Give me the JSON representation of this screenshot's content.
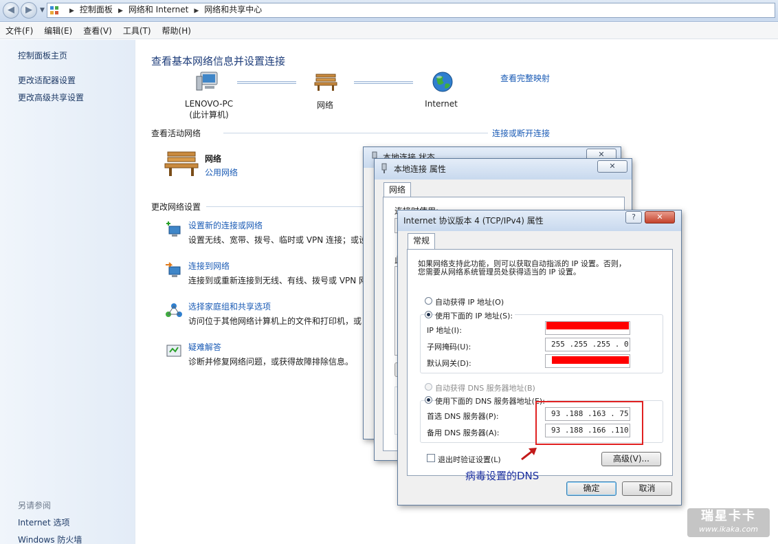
{
  "address_bar": {
    "breadcrumbs": [
      "控制面板",
      "网络和 Internet",
      "网络和共享中心"
    ]
  },
  "menu": [
    "文件(F)",
    "编辑(E)",
    "查看(V)",
    "工具(T)",
    "帮助(H)"
  ],
  "sidebar": {
    "items": [
      "控制面板主页",
      "更改适配器设置",
      "更改高级共享设置"
    ],
    "see_also_label": "另请参阅",
    "see_also": [
      "Internet 选项",
      "Windows 防火墙"
    ]
  },
  "main": {
    "title": "查看基本网络信息并设置连接",
    "full_map_link": "查看完整映射",
    "map_nodes": [
      {
        "line1": "LENOVO-PC",
        "line2": "(此计算机)"
      },
      {
        "line1": "网络",
        "line2": ""
      },
      {
        "line1": "Internet",
        "line2": ""
      }
    ],
    "active_header": "查看活动网络",
    "connect_link": "连接或断开连接",
    "active_network": {
      "name": "网络",
      "type": "公用网络"
    },
    "change_header": "更改网络设置",
    "tasks": [
      {
        "title": "设置新的连接或网络",
        "desc": "设置无线、宽带、拨号、临时或 VPN 连接；或设"
      },
      {
        "title": "连接到网络",
        "desc": "连接到或重新连接到无线、有线、拨号或 VPN 网"
      },
      {
        "title": "选择家庭组和共享选项",
        "desc": "访问位于其他网络计算机上的文件和打印机，或"
      },
      {
        "title": "疑难解答",
        "desc": "诊断并修复网络问题，或获得故障排除信息。"
      }
    ]
  },
  "status_dialog": {
    "title": "本地连接 状态"
  },
  "props_dialog": {
    "title": "本地连接 属性",
    "tab": "网络",
    "connect_using": "连接时使用:",
    "partial_label": "此"
  },
  "ipv4_dialog": {
    "title": "Internet 协议版本 4 (TCP/IPv4) 属性",
    "help_button": "?",
    "tab": "常规",
    "intro_line1": "如果网络支持此功能，则可以获取自动指派的 IP 设置。否则，",
    "intro_line2": "您需要从网络系统管理员处获得适当的 IP 设置。",
    "auto_ip": "自动获得 IP 地址(O)",
    "use_ip": "使用下面的 IP 地址(S):",
    "ip_label": "IP 地址(I):",
    "subnet_label": "子网掩码(U):",
    "subnet_value": "255 .255 .255 . 0",
    "gateway_label": "默认网关(D):",
    "gateway_value_prefix": "1",
    "auto_dns": "自动获得 DNS 服务器地址(B)",
    "use_dns": "使用下面的 DNS 服务器地址(E):",
    "preferred_dns_label": "首选 DNS 服务器(P):",
    "preferred_dns_value": "93 .188 .163 . 75",
    "alternate_dns_label": "备用 DNS 服务器(A):",
    "alternate_dns_value": "93 .188 .166 .110",
    "validate_label": "退出时验证设置(L)",
    "advanced_button": "高级(V)...",
    "ok_button": "确定",
    "cancel_button": "取消",
    "annotation": "病毒设置的DNS"
  },
  "watermark": {
    "line1": "瑞星卡卡",
    "line2": "www.ikaka.com"
  },
  "colors": {
    "accent_link": "#1a5bb5",
    "title_blue": "#1e3d7a",
    "redaction": "#ff0000",
    "highlight_box": "#e02020",
    "annotation": "#1b2fa0"
  }
}
